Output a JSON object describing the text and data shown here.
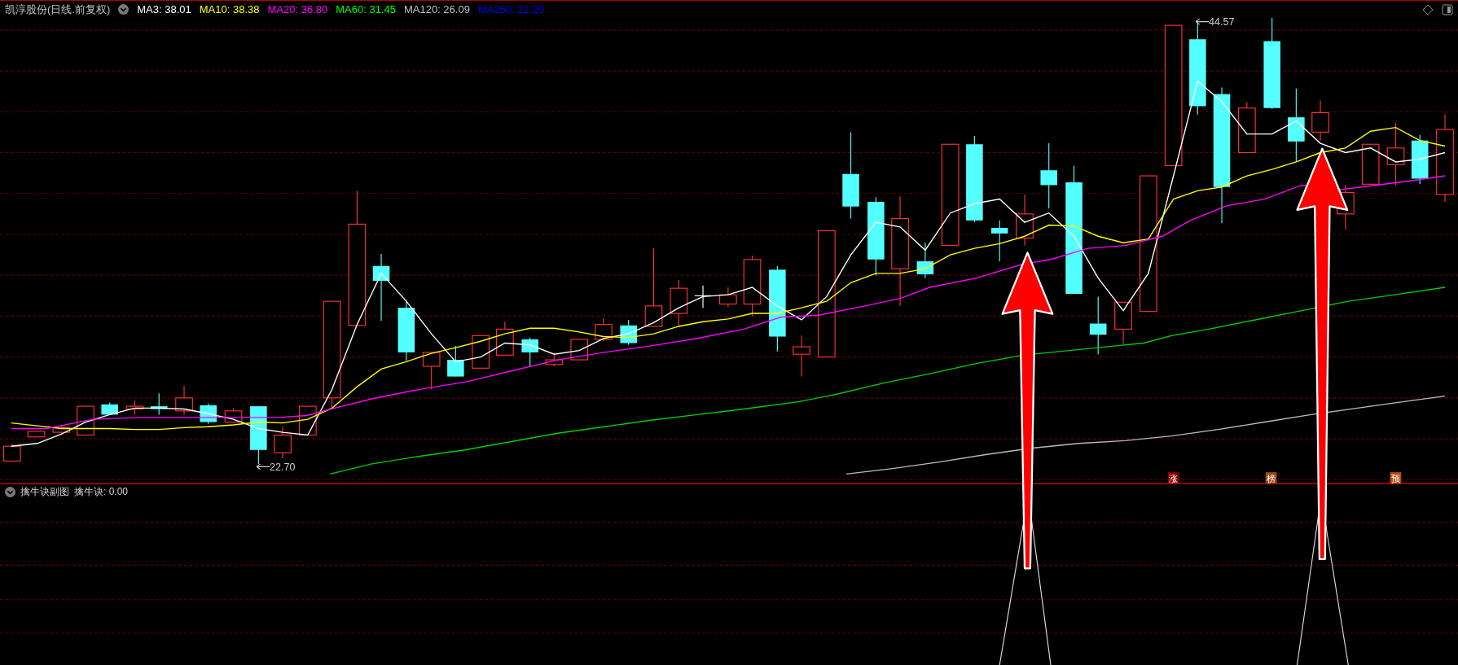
{
  "title": "凯淳股份(日线.前复权)",
  "indicators": [
    {
      "label": "MA3: 38.01",
      "color": "#ffffff"
    },
    {
      "label": "MA10: 38.38",
      "color": "#ffff00"
    },
    {
      "label": "MA20: 36.80",
      "color": "#ff00ff"
    },
    {
      "label": "MA60: 31.45",
      "color": "#00ff00"
    },
    {
      "label": "MA120: 26.09",
      "color": "#c0c0c0"
    },
    {
      "label": "MA250: 22.20",
      "color": "#0000ff"
    }
  ],
  "high_label": "44.57",
  "low_label": "22.70",
  "markers": [
    {
      "text": "涨",
      "color": "#8b0000"
    },
    {
      "text": "榜",
      "color": "#9a4a12"
    },
    {
      "text": "预",
      "color": "#b84a10"
    }
  ],
  "sub_panel": {
    "title": "擒牛诀副图",
    "reading": "擒牛诀: 0.00"
  }
}
